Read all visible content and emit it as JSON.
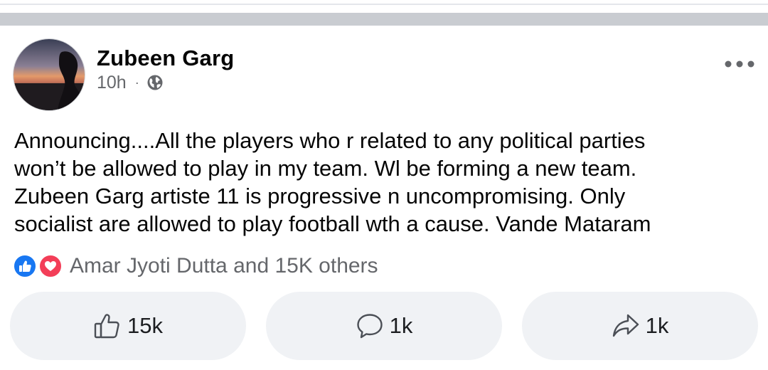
{
  "post": {
    "author": "Zubeen Garg",
    "time": "10h",
    "meta_separator": "·",
    "audience_icon": "globe-icon",
    "more_icon": "more-horizontal-icon",
    "text": "Announcing....All the players who r related to any political parties\nwon’t be allowed to play in my team. Wl be forming a new team.\nZubeen Garg artiste 11 is progressive n uncompromising. Only\nsocialist are allowed to play football wth a cause. Vande Mataram"
  },
  "reactions": {
    "icons": [
      "like-reaction-icon",
      "love-reaction-icon"
    ],
    "summary": "Amar Jyoti Dutta and 15K others"
  },
  "actions": {
    "like": {
      "icon": "thumbs-up-icon",
      "count": "15k"
    },
    "comment": {
      "icon": "comment-bubble-icon",
      "count": "1k"
    },
    "share": {
      "icon": "share-arrow-icon",
      "count": "1k"
    }
  },
  "colors": {
    "accent_blue": "#1877f2",
    "love_red": "#f33e58",
    "secondary_text": "#65676b",
    "button_bg": "#f0f2f5",
    "separator": "#c9ccd1"
  }
}
